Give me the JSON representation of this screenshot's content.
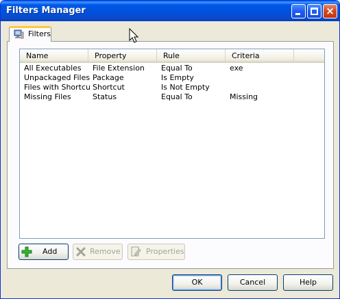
{
  "window": {
    "title": "Filters Manager"
  },
  "tabs": [
    {
      "label": "Filters"
    }
  ],
  "list": {
    "columns": [
      "Name",
      "Property",
      "Rule",
      "Criteria"
    ],
    "rows": [
      [
        "All Executables",
        "File Extension",
        "Equal To",
        "exe"
      ],
      [
        "Unpackaged Files",
        "Package",
        "Is Empty",
        ""
      ],
      [
        "Files with Shortcuts",
        "Shortcut",
        "Is Not Empty",
        ""
      ],
      [
        "Missing Files",
        "Status",
        "Equal To",
        "Missing"
      ]
    ]
  },
  "actions": {
    "add": "Add",
    "remove": "Remove",
    "properties": "Properties"
  },
  "dialog": {
    "ok": "OK",
    "cancel": "Cancel",
    "help": "Help"
  },
  "icons": {
    "tab": "computer-icon",
    "add": "plus-icon",
    "remove": "x-icon",
    "properties": "properties-icon"
  }
}
